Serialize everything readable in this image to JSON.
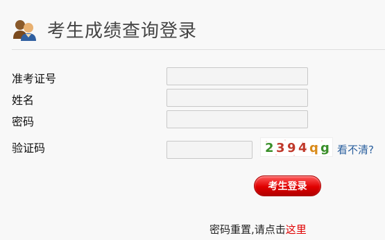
{
  "header": {
    "title": "考生成绩查询登录",
    "icon": "users-icon"
  },
  "form": {
    "exam_id_label": "准考证号",
    "name_label": "姓名",
    "password_label": "密码",
    "captcha_label": "验证码",
    "exam_id_value": "",
    "name_value": "",
    "password_value": "",
    "captcha_value": ""
  },
  "captcha": {
    "code": [
      "2",
      "3",
      "9",
      "4",
      "q",
      "g"
    ],
    "colors": [
      "#3a8f2a",
      "#c0392b",
      "#c0392b",
      "#c0392b",
      "#d98b1a",
      "#3a8f2a"
    ],
    "refresh_label": "看不清?"
  },
  "actions": {
    "login_label": "考生登录"
  },
  "footer": {
    "reset_text": "密码重置,请点击",
    "reset_link": "这里"
  },
  "colors": {
    "accent": "#e00000",
    "link": "#2a5f9e"
  }
}
